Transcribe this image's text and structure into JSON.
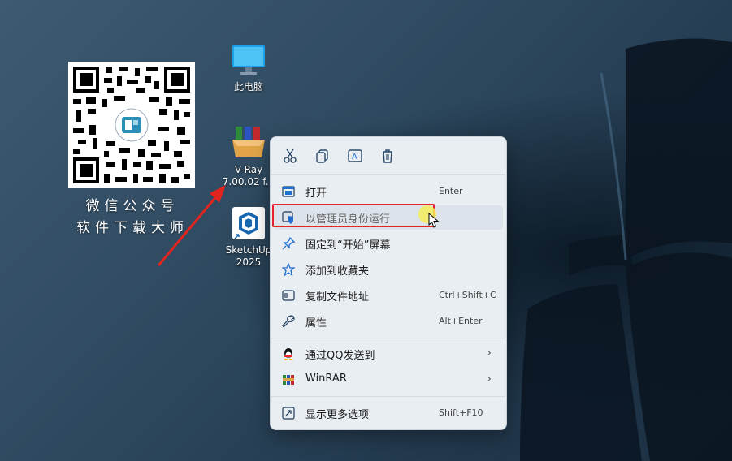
{
  "qr": {
    "caption_line1": "微信公众号",
    "caption_line2": "软件下载大师"
  },
  "desktop": {
    "icons": [
      {
        "label_line1": "此电脑",
        "label_line2": "",
        "icon": "monitor-icon"
      },
      {
        "label_line1": "V-Ray",
        "label_line2": "7.00.02 f...",
        "icon": "winrar-archive-icon"
      },
      {
        "label_line1": "SketchUp",
        "label_line2": "2025",
        "icon": "sketchup-icon"
      }
    ]
  },
  "context_menu": {
    "quick_actions": [
      "cut-icon",
      "copy-icon",
      "rename-icon",
      "delete-icon"
    ],
    "items": [
      {
        "label": "打开",
        "shortcut": "Enter",
        "icon": "open-window-icon"
      },
      {
        "label": "以管理员身份运行",
        "shortcut": "",
        "icon": "shield-icon"
      },
      {
        "label": "固定到“开始”屏幕",
        "shortcut": "",
        "icon": "pin-icon"
      },
      {
        "label": "添加到收藏夹",
        "shortcut": "",
        "icon": "star-icon"
      },
      {
        "label": "复制文件地址",
        "shortcut": "Ctrl+Shift+C",
        "icon": "path-icon"
      },
      {
        "label": "属性",
        "shortcut": "Alt+Enter",
        "icon": "wrench-icon"
      },
      {
        "label": "通过QQ发送到",
        "shortcut": "",
        "icon": "qq-penguin-icon"
      },
      {
        "label": "WinRAR",
        "shortcut": "",
        "icon": "winrar-icon"
      },
      {
        "label": "显示更多选项",
        "shortcut": "Shift+F10",
        "icon": "more-options-icon"
      }
    ]
  },
  "colors": {
    "highlight_box": "#e3242b",
    "accent_blue": "#1f6fd1",
    "menu_bg": "#e9eef3"
  }
}
